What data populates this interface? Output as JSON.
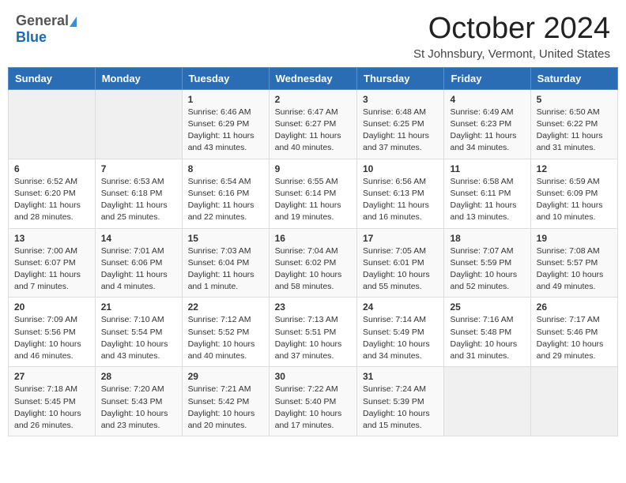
{
  "header": {
    "logo_general": "General",
    "logo_blue": "Blue",
    "month_title": "October 2024",
    "location": "St Johnsbury, Vermont, United States"
  },
  "weekdays": [
    "Sunday",
    "Monday",
    "Tuesday",
    "Wednesday",
    "Thursday",
    "Friday",
    "Saturday"
  ],
  "weeks": [
    [
      {
        "day": "",
        "info": ""
      },
      {
        "day": "",
        "info": ""
      },
      {
        "day": "1",
        "info": "Sunrise: 6:46 AM\nSunset: 6:29 PM\nDaylight: 11 hours and 43 minutes."
      },
      {
        "day": "2",
        "info": "Sunrise: 6:47 AM\nSunset: 6:27 PM\nDaylight: 11 hours and 40 minutes."
      },
      {
        "day": "3",
        "info": "Sunrise: 6:48 AM\nSunset: 6:25 PM\nDaylight: 11 hours and 37 minutes."
      },
      {
        "day": "4",
        "info": "Sunrise: 6:49 AM\nSunset: 6:23 PM\nDaylight: 11 hours and 34 minutes."
      },
      {
        "day": "5",
        "info": "Sunrise: 6:50 AM\nSunset: 6:22 PM\nDaylight: 11 hours and 31 minutes."
      }
    ],
    [
      {
        "day": "6",
        "info": "Sunrise: 6:52 AM\nSunset: 6:20 PM\nDaylight: 11 hours and 28 minutes."
      },
      {
        "day": "7",
        "info": "Sunrise: 6:53 AM\nSunset: 6:18 PM\nDaylight: 11 hours and 25 minutes."
      },
      {
        "day": "8",
        "info": "Sunrise: 6:54 AM\nSunset: 6:16 PM\nDaylight: 11 hours and 22 minutes."
      },
      {
        "day": "9",
        "info": "Sunrise: 6:55 AM\nSunset: 6:14 PM\nDaylight: 11 hours and 19 minutes."
      },
      {
        "day": "10",
        "info": "Sunrise: 6:56 AM\nSunset: 6:13 PM\nDaylight: 11 hours and 16 minutes."
      },
      {
        "day": "11",
        "info": "Sunrise: 6:58 AM\nSunset: 6:11 PM\nDaylight: 11 hours and 13 minutes."
      },
      {
        "day": "12",
        "info": "Sunrise: 6:59 AM\nSunset: 6:09 PM\nDaylight: 11 hours and 10 minutes."
      }
    ],
    [
      {
        "day": "13",
        "info": "Sunrise: 7:00 AM\nSunset: 6:07 PM\nDaylight: 11 hours and 7 minutes."
      },
      {
        "day": "14",
        "info": "Sunrise: 7:01 AM\nSunset: 6:06 PM\nDaylight: 11 hours and 4 minutes."
      },
      {
        "day": "15",
        "info": "Sunrise: 7:03 AM\nSunset: 6:04 PM\nDaylight: 11 hours and 1 minute."
      },
      {
        "day": "16",
        "info": "Sunrise: 7:04 AM\nSunset: 6:02 PM\nDaylight: 10 hours and 58 minutes."
      },
      {
        "day": "17",
        "info": "Sunrise: 7:05 AM\nSunset: 6:01 PM\nDaylight: 10 hours and 55 minutes."
      },
      {
        "day": "18",
        "info": "Sunrise: 7:07 AM\nSunset: 5:59 PM\nDaylight: 10 hours and 52 minutes."
      },
      {
        "day": "19",
        "info": "Sunrise: 7:08 AM\nSunset: 5:57 PM\nDaylight: 10 hours and 49 minutes."
      }
    ],
    [
      {
        "day": "20",
        "info": "Sunrise: 7:09 AM\nSunset: 5:56 PM\nDaylight: 10 hours and 46 minutes."
      },
      {
        "day": "21",
        "info": "Sunrise: 7:10 AM\nSunset: 5:54 PM\nDaylight: 10 hours and 43 minutes."
      },
      {
        "day": "22",
        "info": "Sunrise: 7:12 AM\nSunset: 5:52 PM\nDaylight: 10 hours and 40 minutes."
      },
      {
        "day": "23",
        "info": "Sunrise: 7:13 AM\nSunset: 5:51 PM\nDaylight: 10 hours and 37 minutes."
      },
      {
        "day": "24",
        "info": "Sunrise: 7:14 AM\nSunset: 5:49 PM\nDaylight: 10 hours and 34 minutes."
      },
      {
        "day": "25",
        "info": "Sunrise: 7:16 AM\nSunset: 5:48 PM\nDaylight: 10 hours and 31 minutes."
      },
      {
        "day": "26",
        "info": "Sunrise: 7:17 AM\nSunset: 5:46 PM\nDaylight: 10 hours and 29 minutes."
      }
    ],
    [
      {
        "day": "27",
        "info": "Sunrise: 7:18 AM\nSunset: 5:45 PM\nDaylight: 10 hours and 26 minutes."
      },
      {
        "day": "28",
        "info": "Sunrise: 7:20 AM\nSunset: 5:43 PM\nDaylight: 10 hours and 23 minutes."
      },
      {
        "day": "29",
        "info": "Sunrise: 7:21 AM\nSunset: 5:42 PM\nDaylight: 10 hours and 20 minutes."
      },
      {
        "day": "30",
        "info": "Sunrise: 7:22 AM\nSunset: 5:40 PM\nDaylight: 10 hours and 17 minutes."
      },
      {
        "day": "31",
        "info": "Sunrise: 7:24 AM\nSunset: 5:39 PM\nDaylight: 10 hours and 15 minutes."
      },
      {
        "day": "",
        "info": ""
      },
      {
        "day": "",
        "info": ""
      }
    ]
  ]
}
